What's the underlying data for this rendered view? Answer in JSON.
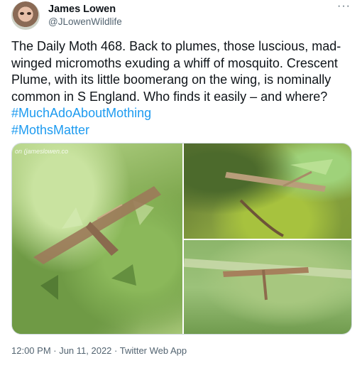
{
  "author": {
    "name": "James Lowen",
    "handle": "@JLowenWildlife"
  },
  "more_label": "···",
  "tweet": {
    "text": "The Daily Moth 468. Back to plumes, those luscious, mad-winged micromoths exuding a whiff of mosquito. Crescent Plume, with its little boomerang on the wing, is nominally common in S England. Who finds it easily – and where?",
    "hashtags": [
      "#MuchAdoAboutMothing",
      "#MothsMatter"
    ]
  },
  "media": {
    "watermark": "on (jameslowen.co"
  },
  "meta": {
    "timestamp": "12:00 PM · Jun 11, 2022 · Twitter Web App"
  }
}
